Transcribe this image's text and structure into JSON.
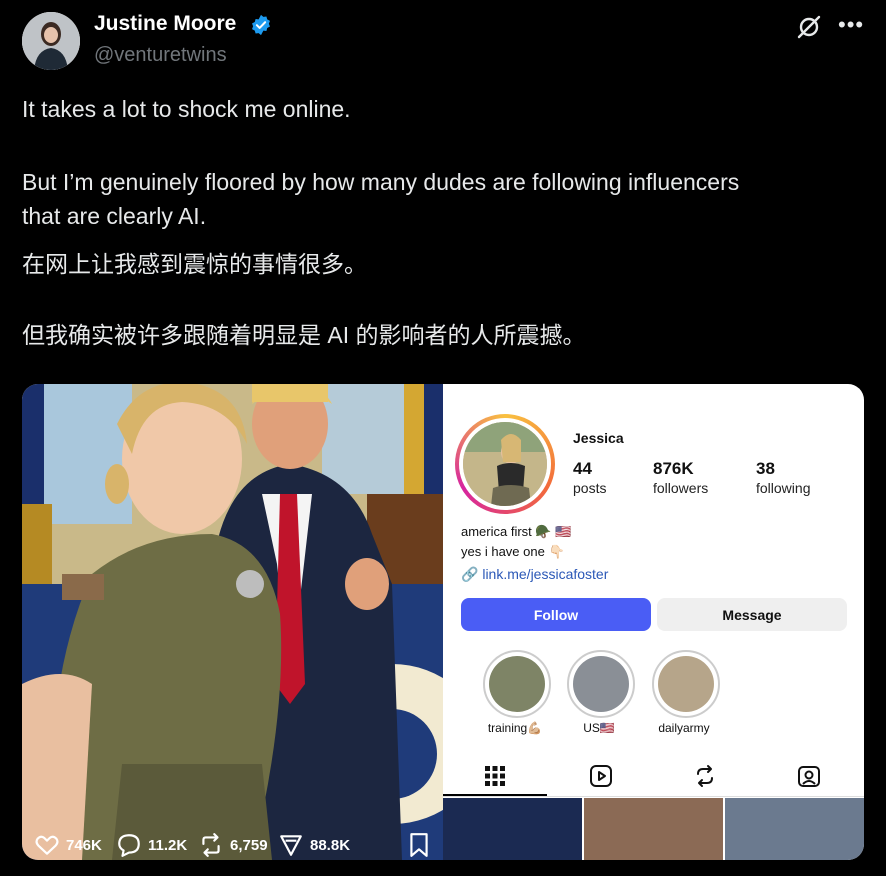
{
  "author": {
    "name": "Justine Moore",
    "handle": "@venturetwins",
    "verified": true
  },
  "icons": {
    "verified": "verified-badge-icon",
    "grok": "grok-icon",
    "more": "more-icon"
  },
  "tweet": {
    "line1": "It takes a lot to shock me online.",
    "line2": "But I’m genuinely floored by how many dudes are following influencers",
    "line3": "that are clearly AI.",
    "line4": "在网上让我感到震惊的事情很多。",
    "line5": "但我确实被许多跟随着明显是 AI 的影响者的人所震撼。"
  },
  "instagram": {
    "username": "Jessica",
    "stats": [
      {
        "value": "44",
        "label": "posts"
      },
      {
        "value": "876K",
        "label": "followers"
      },
      {
        "value": "38",
        "label": "following"
      }
    ],
    "bio_line1": "america first 🪖 🇺🇸",
    "bio_line2": "yes i have one 👇🏻",
    "link": "link.me/jessicafoster",
    "follow_label": "Follow",
    "message_label": "Message",
    "highlights": [
      {
        "label": "training💪🏼"
      },
      {
        "label": "US🇺🇸"
      },
      {
        "label": "dailyarmy"
      }
    ]
  },
  "actions": {
    "likes": "746K",
    "replies": "11.2K",
    "reposts": "6,759",
    "views": "88.8K"
  },
  "colors": {
    "background": "#000000",
    "verified": "#1d9bf0",
    "follow_button": "#4a5df5",
    "link": "#2b58b7"
  }
}
